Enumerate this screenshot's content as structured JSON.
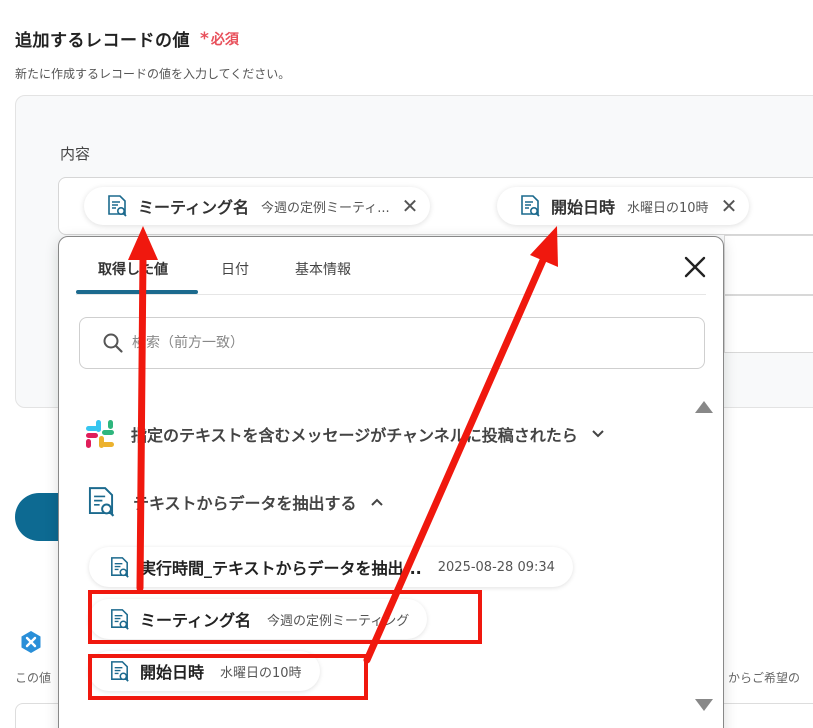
{
  "section": {
    "title": "追加するレコードの値",
    "required_star": "*",
    "required_label": "必須",
    "description": "新たに作成するレコードの値を入力してください。"
  },
  "field": {
    "label": "内容",
    "chips": [
      {
        "label": "ミーティング名",
        "value": "今週の定例ミーティ...",
        "icon": "document-search-icon",
        "close": "✕"
      },
      {
        "label": "開始日時",
        "value": "水曜日の10時",
        "icon": "document-search-icon",
        "close": "✕"
      }
    ]
  },
  "background": {
    "left_text": "この値",
    "right_text": "からご希望の"
  },
  "popup": {
    "tabs": [
      "取得した値",
      "日付",
      "基本情報"
    ],
    "active_tab": 0,
    "search": {
      "placeholder": "検索（前方一致）"
    },
    "groups": [
      {
        "title": "指定のテキストを含むメッセージがチャンネルに投稿されたら",
        "icon": "slack-icon",
        "expanded": false
      },
      {
        "title": "テキストからデータを抽出する",
        "icon": "document-search-icon",
        "expanded": true
      }
    ],
    "items": [
      {
        "label": "実行時間_テキストからデータを抽出...",
        "value": "2025-08-28 09:34"
      },
      {
        "label": "ミーティング名",
        "value": "今週の定例ミーティング"
      },
      {
        "label": "開始日時",
        "value": "水曜日の10時"
      }
    ]
  },
  "colors": {
    "accent": "#1c6a8e",
    "required": "#e8505b",
    "annotation": "#f0180e"
  }
}
